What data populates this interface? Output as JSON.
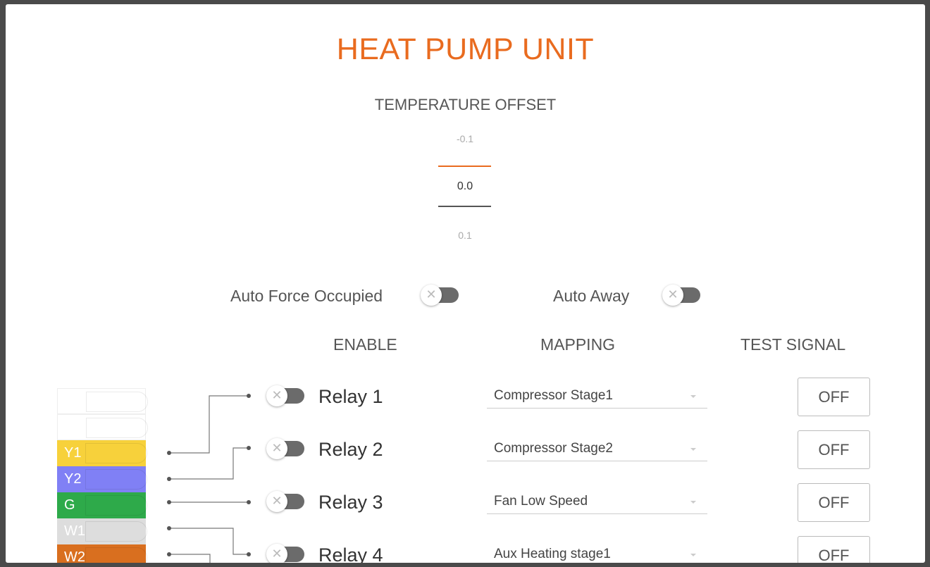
{
  "title": "HEAT PUMP UNIT",
  "temperature_offset": {
    "label": "TEMPERATURE OFFSET",
    "prev": "-0.1",
    "current": "0.0",
    "next": "0.1"
  },
  "toggles": {
    "auto_force_occupied": "Auto Force Occupied",
    "auto_away": "Auto Away"
  },
  "columns": {
    "enable": "ENABLE",
    "mapping": "MAPPING",
    "test_signal": "TEST SIGNAL"
  },
  "relays": [
    {
      "label": "Relay 1",
      "mapping": "Compressor Stage1",
      "test": "OFF"
    },
    {
      "label": "Relay 2",
      "mapping": "Compressor Stage2",
      "test": "OFF"
    },
    {
      "label": "Relay 3",
      "mapping": "Fan Low Speed",
      "test": "OFF"
    },
    {
      "label": "Relay 4",
      "mapping": "Aux Heating stage1",
      "test": "OFF"
    }
  ],
  "terminals": [
    {
      "label": "",
      "color": "#ffffff"
    },
    {
      "label": "",
      "color": "#ffffff"
    },
    {
      "label": "Y1",
      "color": "#f7d13b"
    },
    {
      "label": "Y2",
      "color": "#8080f5"
    },
    {
      "label": "G",
      "color": "#2eaa4a"
    },
    {
      "label": "W1",
      "color": "#dddddd"
    },
    {
      "label": "W2",
      "color": "#d96f1f"
    }
  ],
  "colors": {
    "accent": "#e96b1f",
    "switch_off": "#6b6b6b"
  }
}
